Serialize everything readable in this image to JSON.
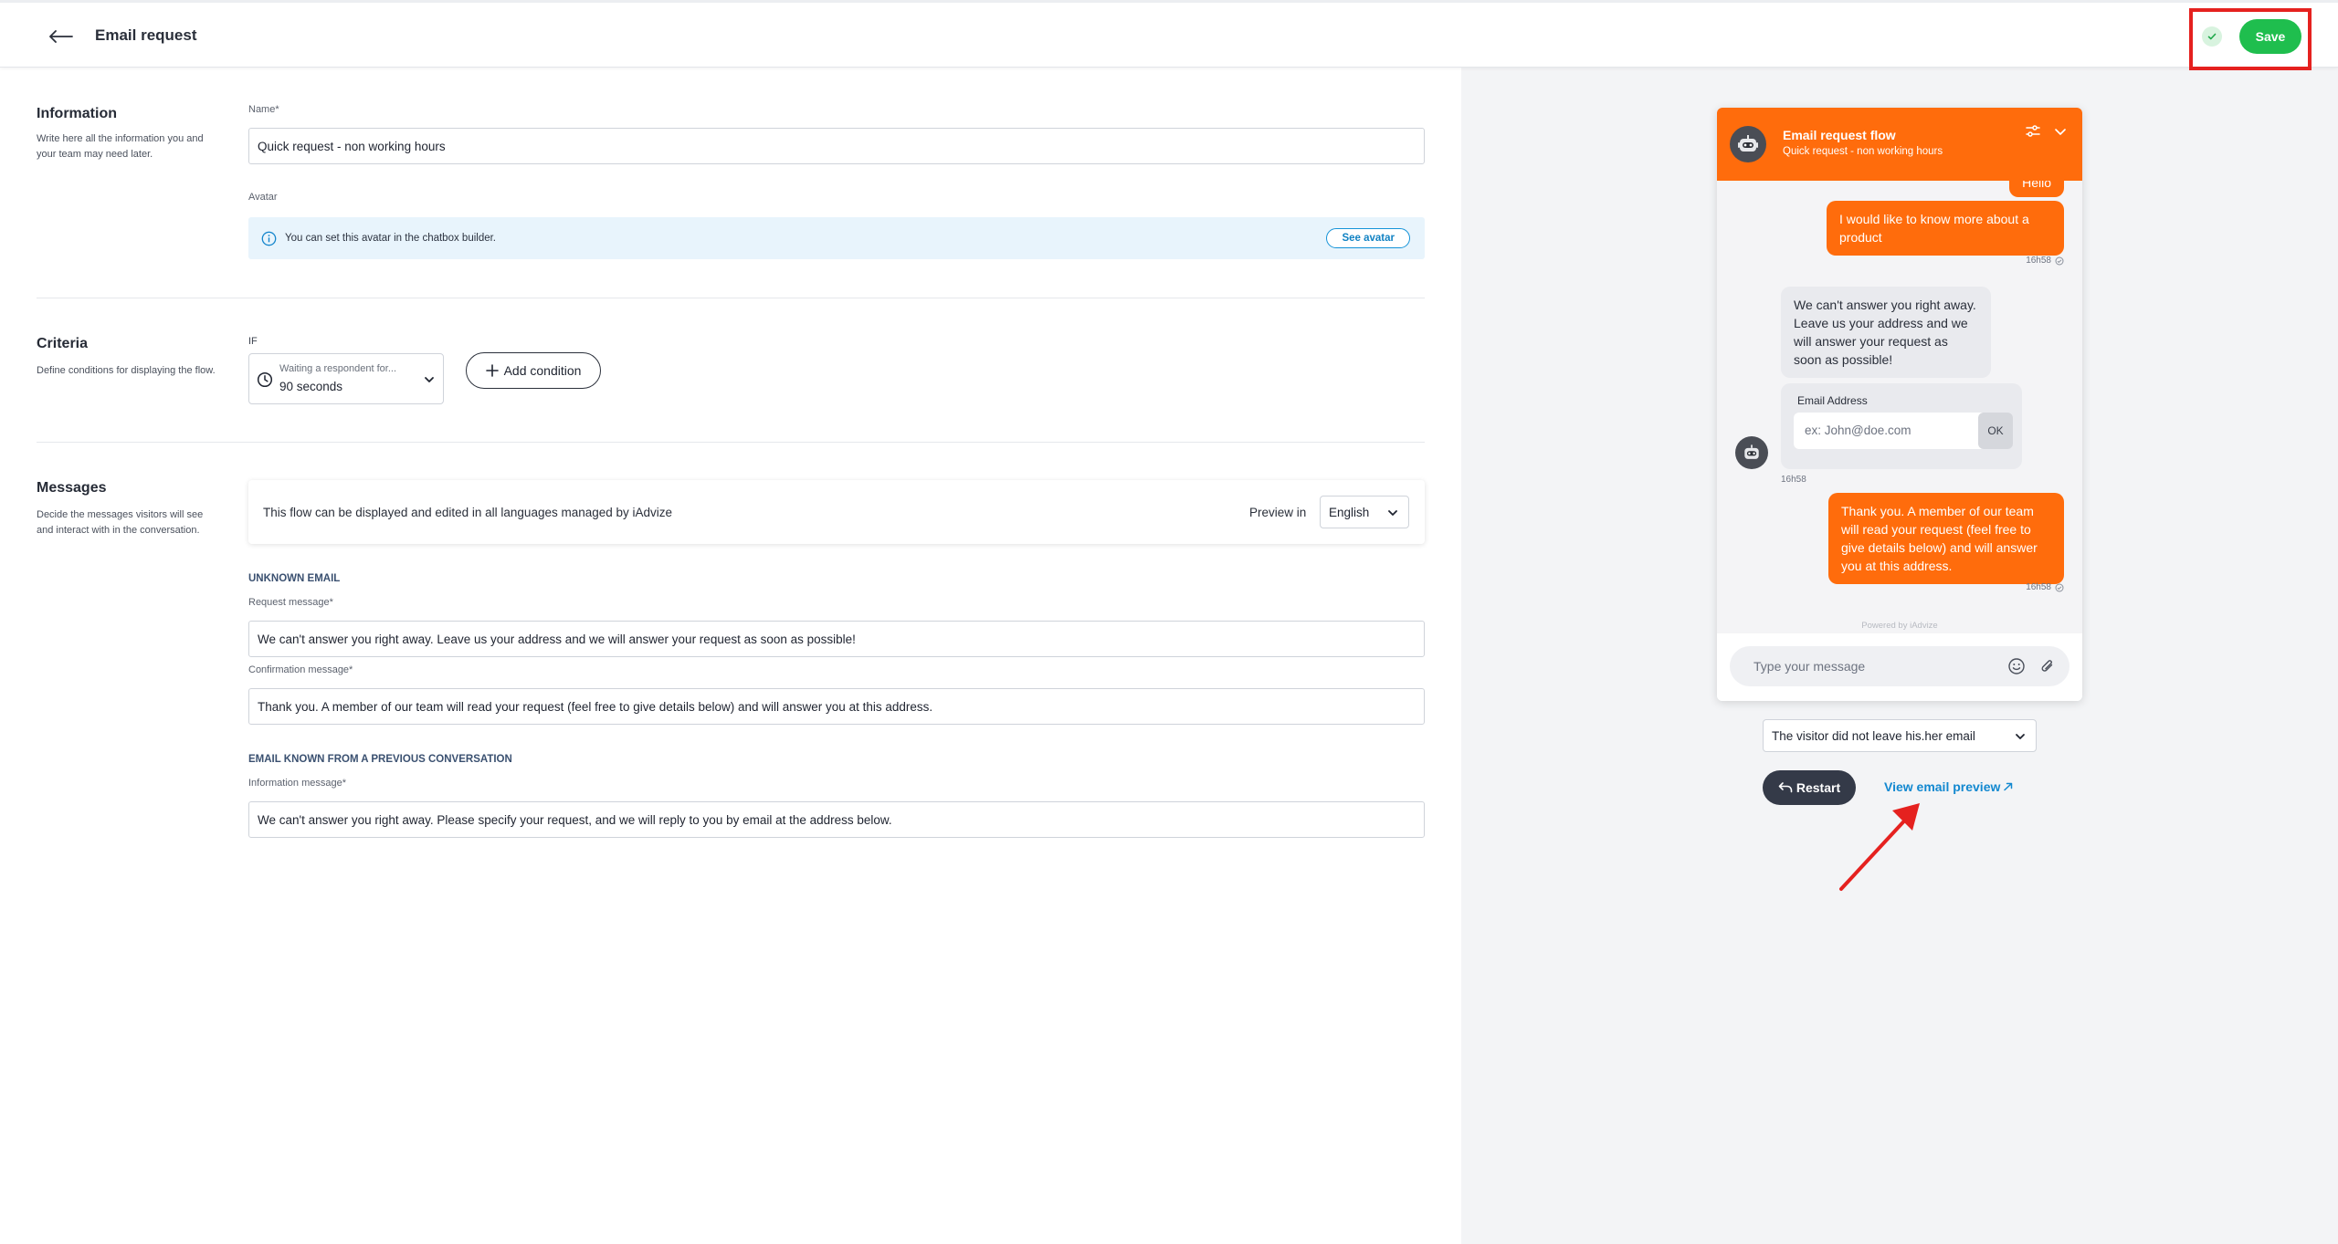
{
  "header": {
    "title": "Email request",
    "save_label": "Save"
  },
  "information": {
    "title": "Information",
    "description": "Write here all the information you and your team may need later.",
    "name_label": "Name*",
    "name_value": "Quick request - non working hours",
    "avatar_label": "Avatar",
    "avatar_info": "You can set this avatar in the chatbox builder.",
    "see_avatar_label": "See avatar"
  },
  "criteria": {
    "title": "Criteria",
    "description": "Define conditions for displaying the flow.",
    "if_label": "IF",
    "condition_hint": "Waiting a respondent for...",
    "condition_value": "90 seconds",
    "add_condition_label": "Add condition"
  },
  "messages": {
    "title": "Messages",
    "description": "Decide the messages visitors will see and interact with in the conversation.",
    "languages_text": "This flow can be displayed and edited in all languages managed by iAdvize",
    "preview_in_label": "Preview in",
    "preview_language": "English",
    "unknown_email_heading": "UNKNOWN EMAIL",
    "request_label": "Request message*",
    "request_value": "We can't answer you right away. Leave us your address and we will answer your request as soon as possible!",
    "confirmation_label": "Confirmation message*",
    "confirmation_value": "Thank you. A member of our team will read your request (feel free to give details below) and will answer you at this address.",
    "known_email_heading": "EMAIL KNOWN FROM A PREVIOUS CONVERSATION",
    "information_label": "Information message*",
    "information_value": "We can't answer you right away. Please specify your request, and we will reply to you by email at the address below."
  },
  "preview": {
    "chat_title": "Email request flow",
    "chat_subtitle": "Quick request - non working hours",
    "msg_hello": "Hello",
    "msg_visitor": "I would like to know more about a product",
    "time_1": "16h58",
    "msg_bot": "We can't answer you right away. Leave us your address and we will answer your request as soon as possible!",
    "email_address_label": "Email Address",
    "email_placeholder": "ex: John@doe.com",
    "ok_label": "OK",
    "time_2": "16h58",
    "msg_confirmation": "Thank you. A member of our team will read your request (feel free to give details below) and will answer you at this address.",
    "time_3": "16h58",
    "powered_by": "Powered by iAdvize",
    "message_placeholder": "Type your message",
    "scenario_value": "The visitor did not leave his.her email",
    "restart_label": "Restart",
    "email_preview_link": "View email preview"
  },
  "colors": {
    "accent_orange": "#ff6c0c",
    "save_green": "#1fbe4e",
    "link_blue": "#1288d0",
    "annotation_red": "#e5211f"
  }
}
